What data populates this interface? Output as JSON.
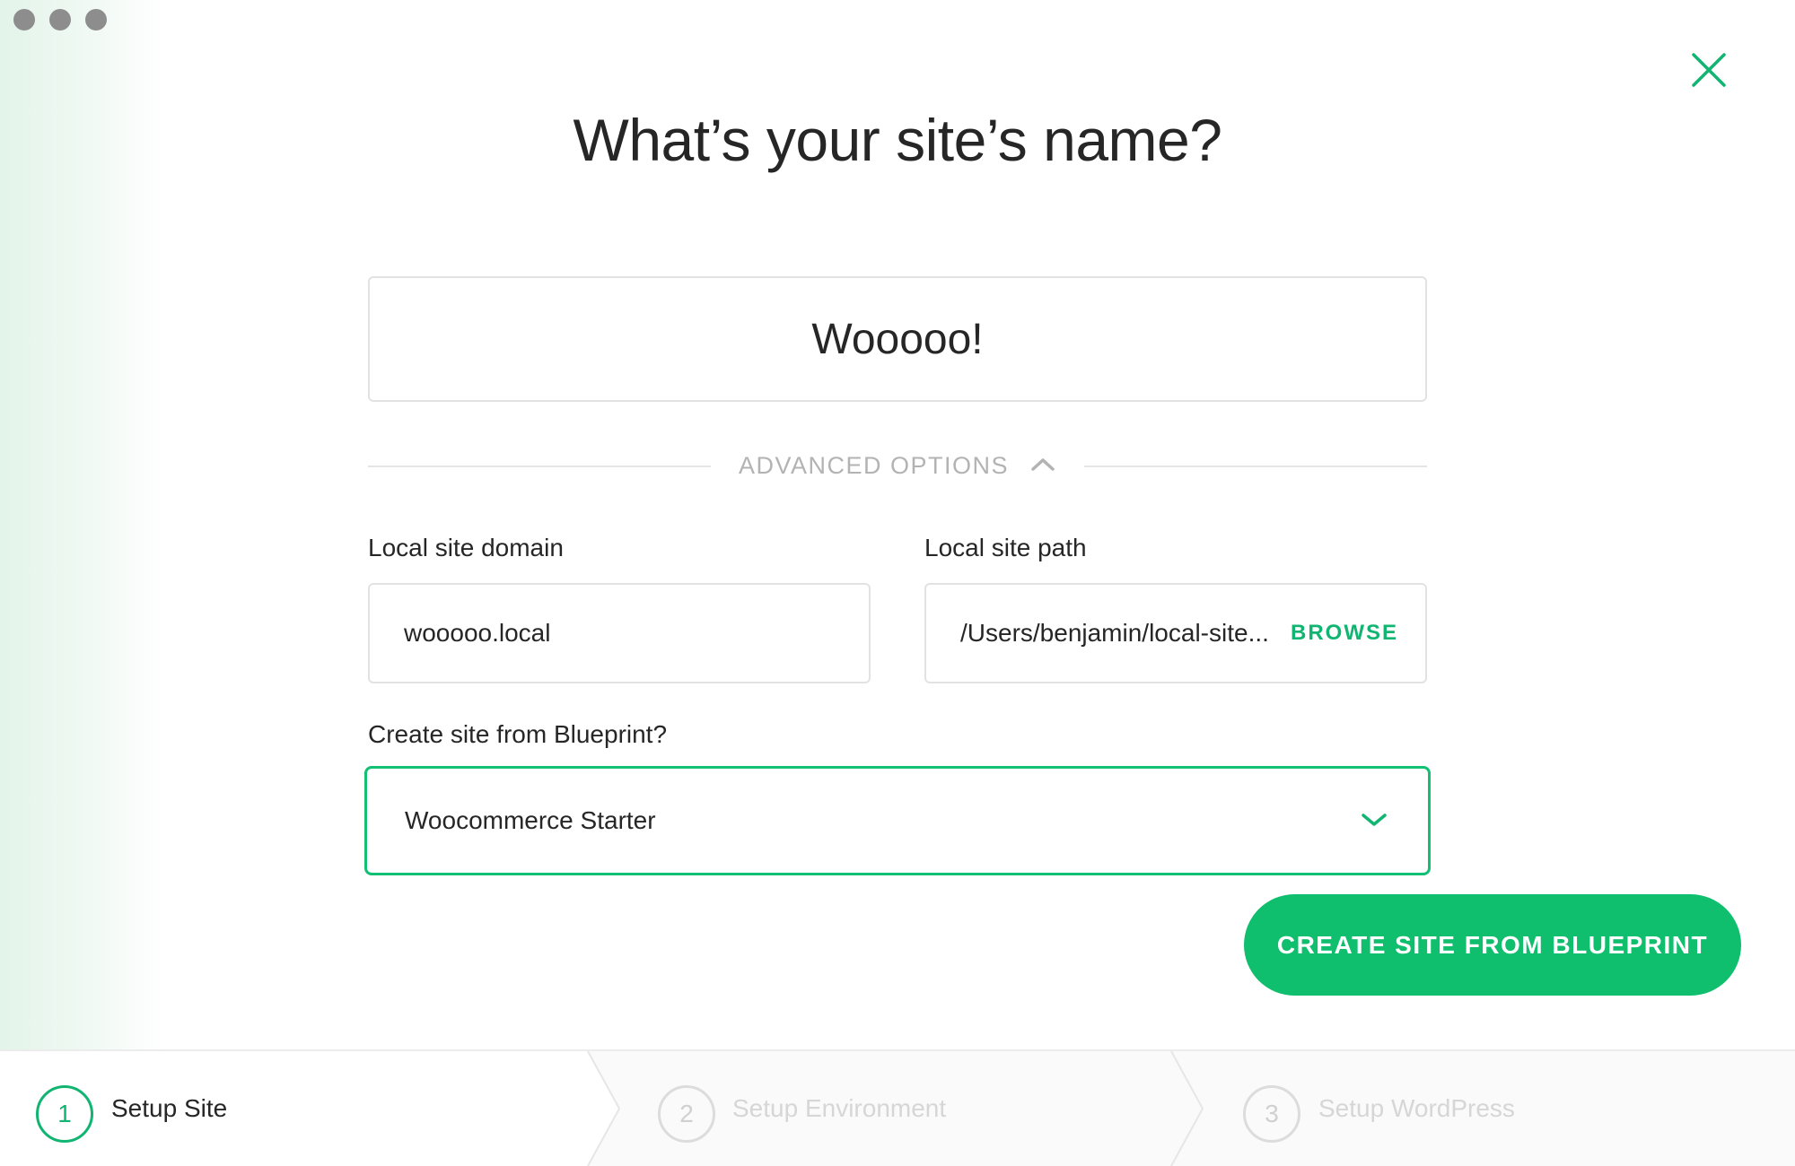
{
  "dialog": {
    "title": "What’s your site’s name?",
    "site_name_value": "Wooooo!"
  },
  "advanced": {
    "label": "ADVANCED OPTIONS",
    "expanded": true
  },
  "fields": {
    "domain_label": "Local site domain",
    "domain_value": "wooooo.local",
    "path_label": "Local site path",
    "path_value": "/Users/benjamin/local-site...",
    "browse_label": "BROWSE",
    "blueprint_label": "Create site from Blueprint?",
    "blueprint_selected": "Woocommerce Starter"
  },
  "actions": {
    "create_label": "CREATE SITE FROM BLUEPRINT"
  },
  "steps": [
    {
      "number": "1",
      "label": "Setup Site",
      "state": "active"
    },
    {
      "number": "2",
      "label": "Setup Environment",
      "state": "inactive"
    },
    {
      "number": "3",
      "label": "Setup WordPress",
      "state": "inactive"
    }
  ],
  "colors": {
    "accent": "#0fbf6e",
    "inactive_text": "#d6d6d6",
    "window_control": "#8d8d8d"
  },
  "icons": {
    "close": "close-icon",
    "advanced_toggle": "chevron-up-icon",
    "select": "chevron-down-icon"
  }
}
